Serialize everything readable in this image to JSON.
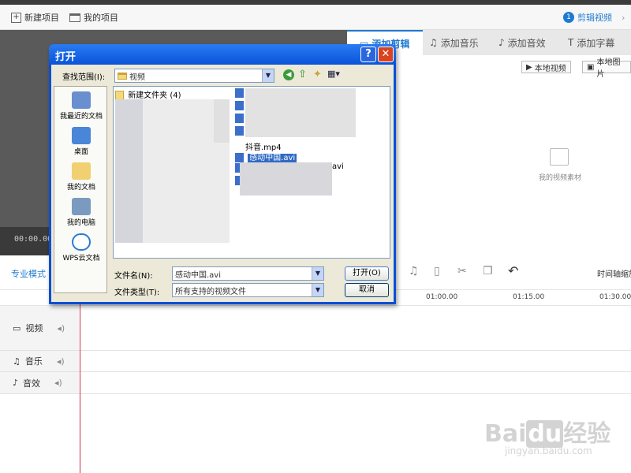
{
  "toolbar": {
    "new_project": "新建项目",
    "my_projects": "我的项目",
    "step_number": "1",
    "step_label": "剪辑视频"
  },
  "preview": {
    "timecode": "00:00.00"
  },
  "tabs": [
    {
      "label": "添加剪辑",
      "icon": "clip-icon"
    },
    {
      "label": "添加音乐",
      "icon": "music-note-icon"
    },
    {
      "label": "添加音效",
      "icon": "sound-effect-icon"
    },
    {
      "label": "添加字幕",
      "icon": "text-icon"
    }
  ],
  "media": {
    "local_video": "本地视频",
    "local_image": "本地图片",
    "empty_label": "我的视频素材"
  },
  "mode": {
    "label": "专业模式",
    "zoom_label": "时间轴缩放"
  },
  "ruler": [
    "01:00.00",
    "01:15.00",
    "01:30.00"
  ],
  "tracks": [
    {
      "label": "视频",
      "icon": "video-camera-icon"
    },
    {
      "label": "音乐",
      "icon": "music-note-icon"
    },
    {
      "label": "音效",
      "icon": "sound-effect-icon"
    }
  ],
  "dialog": {
    "title": "打开",
    "help_glyph": "?",
    "close_glyph": "✕",
    "look_in_label": "查找范围(I):",
    "look_in_value": "视频",
    "places": [
      {
        "label": "我最近的文档",
        "icon": "recent-documents-icon"
      },
      {
        "label": "桌面",
        "icon": "desktop-icon"
      },
      {
        "label": "我的文档",
        "icon": "my-documents-icon"
      },
      {
        "label": "我的电脑",
        "icon": "my-computer-icon"
      },
      {
        "label": "WPS云文档",
        "icon": "wps-cloud-icon"
      }
    ],
    "files": {
      "folder": "新建文件夹 (4)",
      "file_douyin": "抖音.mp4",
      "file_selected": "感动中国.avi",
      "file_partial": "avi"
    },
    "filename_label": "文件名(N):",
    "filename_value": "感动中国.avi",
    "filetype_label": "文件类型(T):",
    "filetype_value": "所有支持的视频文件",
    "open_button": "打开(O)",
    "cancel_button": "取消"
  },
  "watermark": {
    "brand": "Bai",
    "du": "du",
    "product": "经验",
    "url": "jingyan.baidu.com"
  }
}
